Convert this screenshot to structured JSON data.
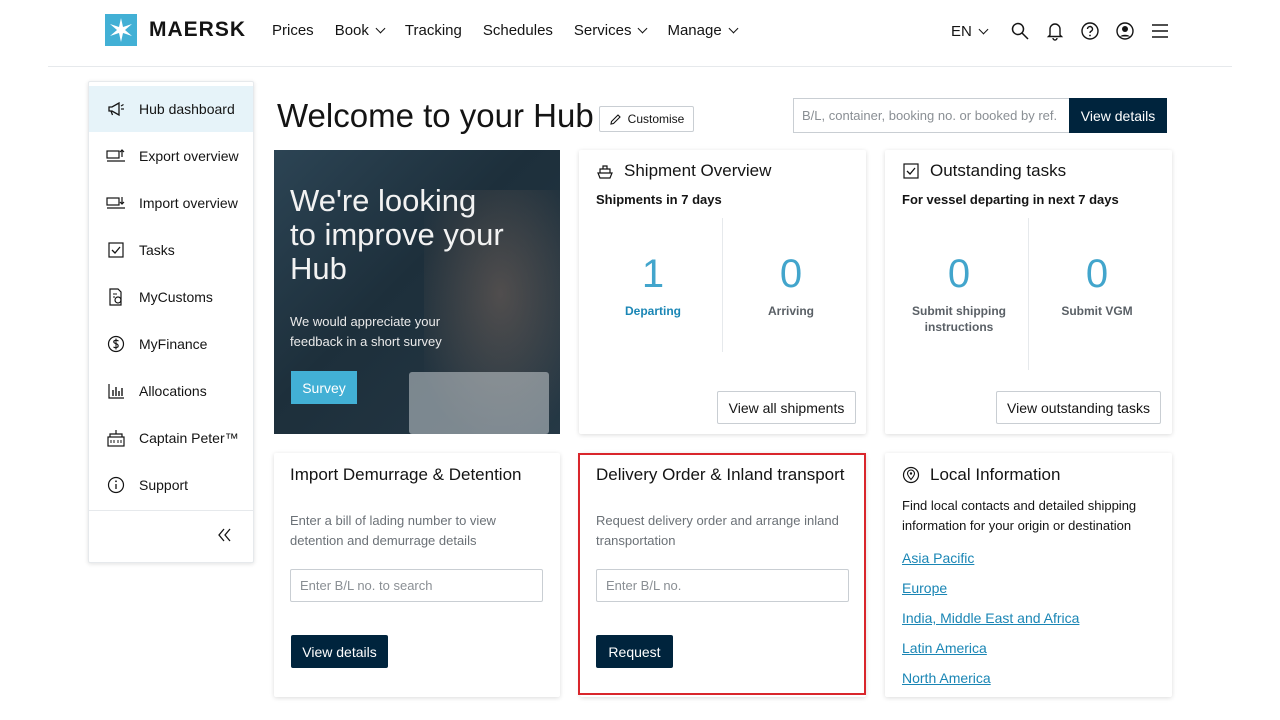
{
  "brand": {
    "name": "MAERSK",
    "accent": "#42b0d5",
    "dark": "#00243d"
  },
  "nav": {
    "links": [
      {
        "label": "Prices",
        "has_dropdown": false
      },
      {
        "label": "Book",
        "has_dropdown": true
      },
      {
        "label": "Tracking",
        "has_dropdown": false
      },
      {
        "label": "Schedules",
        "has_dropdown": false
      },
      {
        "label": "Services",
        "has_dropdown": true
      },
      {
        "label": "Manage",
        "has_dropdown": true
      }
    ],
    "language": "EN",
    "icons": [
      "search-icon",
      "bell-icon",
      "help-icon",
      "account-icon",
      "menu-icon"
    ]
  },
  "sidebar": {
    "items": [
      {
        "label": "Hub dashboard",
        "icon": "megaphone-icon",
        "active": true
      },
      {
        "label": "Export overview",
        "icon": "export-icon"
      },
      {
        "label": "Import overview",
        "icon": "import-icon"
      },
      {
        "label": "Tasks",
        "icon": "checkbox-icon"
      },
      {
        "label": "MyCustoms",
        "icon": "customs-icon"
      },
      {
        "label": "MyFinance",
        "icon": "finance-icon"
      },
      {
        "label": "Allocations",
        "icon": "bar-chart-icon"
      },
      {
        "label": "Captain Peter™",
        "icon": "captain-icon"
      },
      {
        "label": "Support",
        "icon": "info-icon"
      }
    ],
    "collapse_icon": "double-chevron-left-icon"
  },
  "header": {
    "title": "Welcome to your Hub",
    "customise_label": "Customise",
    "search_placeholder": "B/L, container, booking no. or booked by ref.",
    "view_details_label": "View details"
  },
  "promo": {
    "headline": "We're looking to improve your Hub",
    "body": "We would appreciate your feedback in a short survey",
    "button_label": "Survey"
  },
  "shipment_overview": {
    "title": "Shipment Overview",
    "subtitle": "Shipments in 7 days",
    "stats": [
      {
        "value": "1",
        "label": "Departing"
      },
      {
        "value": "0",
        "label": "Arriving"
      }
    ],
    "button_label": "View all shipments"
  },
  "outstanding_tasks": {
    "title": "Outstanding tasks",
    "subtitle": "For vessel departing in next 7 days",
    "stats": [
      {
        "value": "0",
        "label": "Submit shipping instructions"
      },
      {
        "value": "0",
        "label": "Submit VGM"
      }
    ],
    "button_label": "View outstanding tasks"
  },
  "demurrage": {
    "title": "Import Demurrage & Detention",
    "description": "Enter a bill of lading number to view detention and demurrage details",
    "input_placeholder": "Enter B/L no. to search",
    "button_label": "View details"
  },
  "delivery_order": {
    "title": "Delivery Order & Inland transport",
    "description": "Request delivery order and arrange inland transportation",
    "input_placeholder": "Enter B/L no.",
    "button_label": "Request",
    "highlight_color": "#d9262c"
  },
  "local_info": {
    "title": "Local Information",
    "description": "Find local contacts and detailed shipping information for your origin or destination",
    "regions": [
      "Asia Pacific",
      "Europe",
      "India, Middle East and Africa",
      "Latin America",
      "North America"
    ]
  }
}
